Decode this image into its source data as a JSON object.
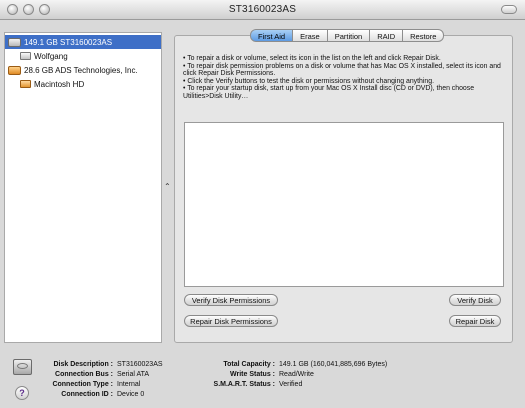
{
  "window": {
    "title": "ST3160023AS"
  },
  "sidebar": {
    "items": [
      {
        "label": "149.1 GB ST3160023AS",
        "icon": "hard-disk-icon",
        "selected": true
      },
      {
        "label": "Wolfgang",
        "icon": "volume-icon"
      },
      {
        "label": "28.6 GB ADS Technologies, Inc.",
        "icon": "external-disk-icon"
      },
      {
        "label": "Macintosh HD",
        "icon": "volume-icon"
      }
    ]
  },
  "splitter": {
    "glyph": "⌃"
  },
  "tabs": [
    {
      "label": "First Aid",
      "active": true
    },
    {
      "label": "Erase"
    },
    {
      "label": "Partition"
    },
    {
      "label": "RAID"
    },
    {
      "label": "Restore"
    }
  ],
  "firstaid": {
    "instructions": [
      "• To repair a disk or volume, select its icon in the list on the left and click Repair Disk.",
      "• To repair disk permission problems on a disk or volume that has Mac OS X installed, select its icon and click Repair Disk Permissions.",
      "• Click the Verify buttons to test the disk or permissions without changing anything.",
      "• To repair your startup disk, start up from your Mac OS X Install disc (CD or DVD), then choose Utilities>Disk Utility…"
    ],
    "verify_permissions": "Verify Disk Permissions",
    "repair_permissions": "Repair Disk Permissions",
    "verify_disk": "Verify Disk",
    "repair_disk": "Repair Disk"
  },
  "info": {
    "left": [
      {
        "label": "Disk Description :",
        "value": "ST3160023AS"
      },
      {
        "label": "Connection Bus :",
        "value": "Serial ATA"
      },
      {
        "label": "Connection Type :",
        "value": "Internal"
      },
      {
        "label": "Connection ID :",
        "value": "Device 0"
      }
    ],
    "right": [
      {
        "label": "Total Capacity :",
        "value": "149.1 GB (160,041,885,696 Bytes)"
      },
      {
        "label": "Write Status :",
        "value": "Read/Write"
      },
      {
        "label": "S.M.A.R.T. Status :",
        "value": "Verified"
      }
    ]
  },
  "help": {
    "glyph": "?"
  },
  "colors": {
    "selection": "#3e6fc7",
    "active_tab": "#5d9be3"
  }
}
